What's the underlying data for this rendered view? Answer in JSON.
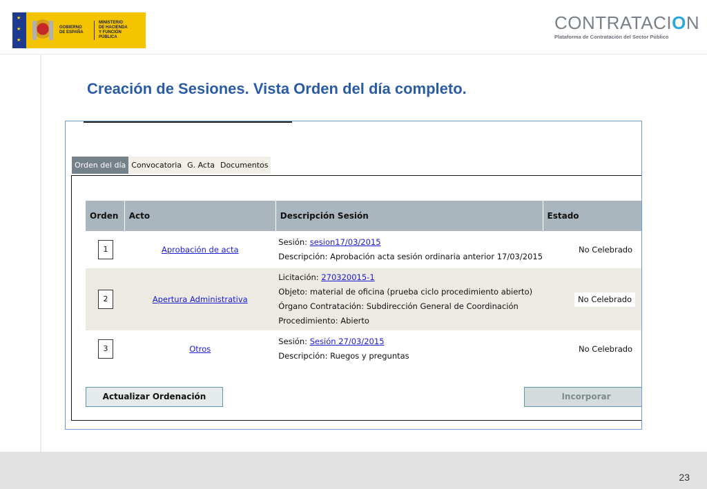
{
  "header": {
    "gov_logo": {
      "flag_icon": "eu-spain-flag-icon",
      "coat_icon": "spain-coat-of-arms-icon",
      "line1": "GOBIERNO",
      "line2": "DE ESPAÑA",
      "min_line1": "MINISTERIO",
      "min_line2": "DE HACIENDA",
      "min_line3": "Y FUNCIÓN PÚBLICA"
    },
    "brand": {
      "title_start": "CONTRATACI",
      "title_power": "O",
      "title_end": "N",
      "subtitle": "Plataforma de Contratación del Sector Público",
      "power_icon": "power-icon"
    }
  },
  "slide_title": "Creación de Sesiones. Vista Orden del día completo.",
  "tabs": [
    {
      "label": "Orden del día",
      "active": true
    },
    {
      "label": "Convocatoria",
      "active": false
    },
    {
      "label": "G. Acta",
      "active": false
    },
    {
      "label": "Documentos",
      "active": false
    }
  ],
  "table": {
    "headers": [
      "Orden",
      "Acto",
      "Descripción Sesión",
      "Estado"
    ],
    "rows": [
      {
        "orden": "1",
        "acto": "Aprobación de acta",
        "desc1_label": "Sesión: ",
        "desc1_link": "sesion17/03/2015",
        "desc2": "Descripción: Aprobación acta sesión ordinaria anterior 17/03/2015",
        "estado": "No Celebrado"
      },
      {
        "orden": "2",
        "acto": "Apertura Administrativa",
        "desc1_label": "Licitación: ",
        "desc1_link": "270320015-1",
        "desc2": "Objeto: material de oficina (prueba ciclo procedimiento abierto)",
        "desc3": "Órgano Contratación: Subdirección General de Coordinación",
        "desc4": "Procedimiento: Abierto",
        "estado": "No Celebrado"
      },
      {
        "orden": "3",
        "acto": "Otros",
        "desc1_label": "Sesión: ",
        "desc1_link": "Sesión 27/03/2015",
        "desc2": "Descripción: Ruegos y preguntas",
        "estado": "No Celebrado"
      }
    ]
  },
  "buttons": {
    "actualizar": "Actualizar Ordenación",
    "incorporar": "Incorporar"
  },
  "footer": {
    "page_number": "23"
  },
  "colors": {
    "title_blue": "#2a5ba5",
    "brand_accent": "#29a8d9",
    "header_gray": "#a9b6bd",
    "link_blue": "#1b1bd4"
  }
}
